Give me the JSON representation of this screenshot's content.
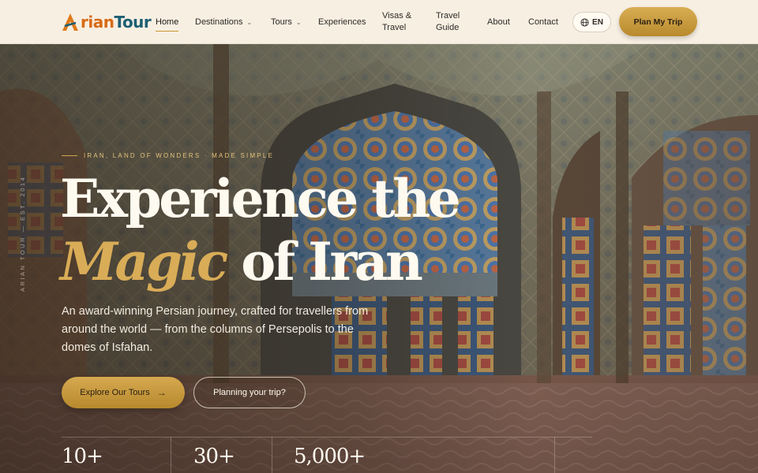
{
  "header": {
    "logo": {
      "part1": "A",
      "part2": "rian",
      "part3": "Tour"
    },
    "nav": [
      {
        "label": "Home"
      },
      {
        "label": "Destinations"
      },
      {
        "label": "Tours"
      },
      {
        "label": "Experiences"
      },
      {
        "label": "Visas &",
        "label2": "Travel"
      },
      {
        "label": "Travel",
        "label2": "Guide"
      },
      {
        "label": "About"
      },
      {
        "label": "Contact"
      }
    ],
    "language": "EN",
    "cta": "Plan My Trip"
  },
  "hero": {
    "vertical_text": "ARIAN TOUR — EST. 2014",
    "eyebrow": "IRAN, LAND OF WONDERS · MADE SIMPLE",
    "headline_line1": "Experience the",
    "headline_magic": "Magic",
    "headline_rest": "of Iran",
    "description": "An award-winning Persian journey, crafted for travellers from around the world — from the columns of Persepolis to the domes of Isfahan.",
    "primary_button": "Explore Our Tours",
    "secondary_button": "Planning your trip?",
    "stats": [
      {
        "value": "10+"
      },
      {
        "value": "30+"
      },
      {
        "value": "5,000+"
      }
    ]
  },
  "colors": {
    "accent": "#d9ac57",
    "header_bg": "#f7efe2",
    "logo_orange": "#e07a1a",
    "logo_teal": "#1e5f74"
  },
  "icons": {
    "language": "globe-icon",
    "nav_dropdown": "chevron-down-icon",
    "primary_button": "arrow-right-icon"
  }
}
